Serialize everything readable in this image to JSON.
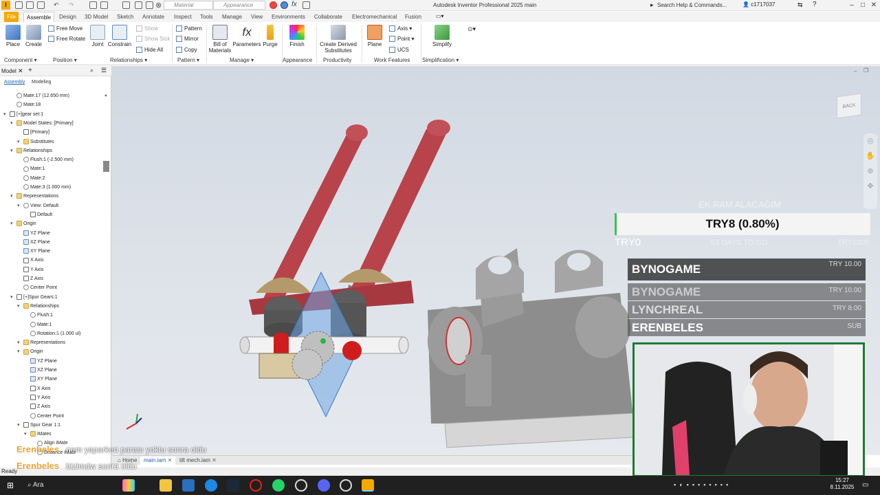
{
  "titlebar": {
    "logo": "I",
    "material": "Material",
    "appearance": "Appearance",
    "title": "Autodesk Inventor Professional 2025   main",
    "search": "Search Help & Commands...",
    "user": "c1717037"
  },
  "tabs": [
    "File",
    "Assemble",
    "Design",
    "3D Model",
    "Sketch",
    "Annotate",
    "Inspect",
    "Tools",
    "Manage",
    "View",
    "Environments",
    "Collaborate",
    "Electromechanical",
    "Fusion"
  ],
  "ribbon": {
    "place": "Place",
    "create": "Create",
    "free_move": "Free Move",
    "free_rotate": "Free Rotate",
    "joint": "Joint",
    "constrain": "Constrain",
    "show": "Show",
    "show_sick": "Show Sick",
    "hide_all": "Hide All",
    "pattern": "Pattern",
    "mirror": "Mirror",
    "copy": "Copy",
    "bom": "Bill of Materials",
    "parameters": "Parameters",
    "purge": "Purge",
    "finish": "Finish",
    "derived": "Create Derived Substitutes",
    "plane": "Plane",
    "axis": "Axis",
    "point": "Point",
    "ucs": "UCS",
    "simplify": "Simplify",
    "groups": [
      "Component",
      "Position",
      "Relationships",
      "Pattern",
      "Manage",
      "Appearance",
      "Productivity",
      "Work Features",
      "Simplification"
    ]
  },
  "panel": {
    "title": "Model",
    "tab_assembly": "Assembly",
    "tab_modeling": "Modeling",
    "items": [
      {
        "label": "Mate:17 (12.650 mm)",
        "indent": 2,
        "icon": "mate"
      },
      {
        "label": "Mate:18",
        "indent": 2,
        "icon": "mate"
      },
      {
        "label": "[+]gear set:1",
        "indent": 1,
        "icon": "asm"
      },
      {
        "label": "Model States: [Primary]",
        "indent": 2,
        "icon": "fold"
      },
      {
        "label": "[Primary]",
        "indent": 3,
        "icon": "check"
      },
      {
        "label": "Substitutes",
        "indent": 3,
        "icon": "fold"
      },
      {
        "label": "Relationships",
        "indent": 2,
        "icon": "fold"
      },
      {
        "label": "Flush:1 (-2.500 mm)",
        "indent": 3,
        "icon": "mate"
      },
      {
        "label": "Mate:1",
        "indent": 3,
        "icon": "mate"
      },
      {
        "label": "Mate:2",
        "indent": 3,
        "icon": "mate"
      },
      {
        "label": "Mate:3 (1.000 mm)",
        "indent": 3,
        "icon": "mate"
      },
      {
        "label": "Representations",
        "indent": 2,
        "icon": "fold"
      },
      {
        "label": "View: Default",
        "indent": 3,
        "icon": "eye"
      },
      {
        "label": "Default",
        "indent": 4,
        "icon": "check"
      },
      {
        "label": "Origin",
        "indent": 2,
        "icon": "fold"
      },
      {
        "label": "YZ Plane",
        "indent": 3,
        "icon": "plane"
      },
      {
        "label": "XZ Plane",
        "indent": 3,
        "icon": "plane"
      },
      {
        "label": "XY Plane",
        "indent": 3,
        "icon": "plane"
      },
      {
        "label": "X Axis",
        "indent": 3,
        "icon": "axis"
      },
      {
        "label": "Y Axis",
        "indent": 3,
        "icon": "axis"
      },
      {
        "label": "Z Axis",
        "indent": 3,
        "icon": "axis"
      },
      {
        "label": "Center Point",
        "indent": 3,
        "icon": "point"
      },
      {
        "label": "[+]Spur Gears:1",
        "indent": 2,
        "icon": "asm"
      },
      {
        "label": "Relationships",
        "indent": 3,
        "icon": "fold"
      },
      {
        "label": "Flush:1",
        "indent": 4,
        "icon": "mate"
      },
      {
        "label": "Mate:1",
        "indent": 4,
        "icon": "mate"
      },
      {
        "label": "Rotation:1 (1.000 ul)",
        "indent": 4,
        "icon": "mate"
      },
      {
        "label": "Representations",
        "indent": 3,
        "icon": "fold"
      },
      {
        "label": "Origin",
        "indent": 3,
        "icon": "fold"
      },
      {
        "label": "YZ Plane",
        "indent": 4,
        "icon": "plane"
      },
      {
        "label": "XZ Plane",
        "indent": 4,
        "icon": "plane"
      },
      {
        "label": "XY Plane",
        "indent": 4,
        "icon": "plane"
      },
      {
        "label": "X Axis",
        "indent": 4,
        "icon": "axis"
      },
      {
        "label": "Y Axis",
        "indent": 4,
        "icon": "axis"
      },
      {
        "label": "Z Axis",
        "indent": 4,
        "icon": "axis"
      },
      {
        "label": "Center Point",
        "indent": 4,
        "icon": "point"
      },
      {
        "label": "Spur Gear 1:1",
        "indent": 3,
        "icon": "part"
      },
      {
        "label": "iMates",
        "indent": 4,
        "icon": "fold"
      },
      {
        "label": "Align iMate",
        "indent": 5,
        "icon": "mate"
      },
      {
        "label": "Distance iMate",
        "indent": 5,
        "icon": "mate"
      }
    ]
  },
  "doctabs": {
    "home": "Home",
    "main": "main.iam",
    "tilt": "tilt mech.iam"
  },
  "status": "Ready",
  "taskbar": {
    "search": "Ara",
    "time": "15:27",
    "date": "8.11.2025"
  },
  "overlay": {
    "goal_title": "EK RAM ALACAĞIM",
    "goal_text": "TRY8 (0.80%)",
    "goal_min": "TRY0",
    "goal_days": "53 DAYS TO GO",
    "goal_max": "TRY1000",
    "goal_progress_percent": 0.8,
    "donations": [
      {
        "name": "BYNOGAME",
        "amount": "TRY 10.00"
      },
      {
        "name": "BYNOGAME",
        "amount": "TRY 10.00"
      },
      {
        "name": "LYNCHREAL",
        "amount": "TRY 8.00"
      },
      {
        "name": "ERENBELES",
        "amount": "SUB"
      }
    ],
    "chat1_user": "Erenbeles",
    "chat1_text": "nem yaparken parası yoktu sonra oldu",
    "chat2_user": "Erenbeles",
    "chat2_text": "bizimdw sonra oldu"
  },
  "viewcube": "BACK",
  "colors": {
    "brand": "#f5a800",
    "accent": "#1a5fb4",
    "rod": "#b8434b",
    "progress": "#36c64f",
    "webcam_border": "#1f7a34"
  }
}
